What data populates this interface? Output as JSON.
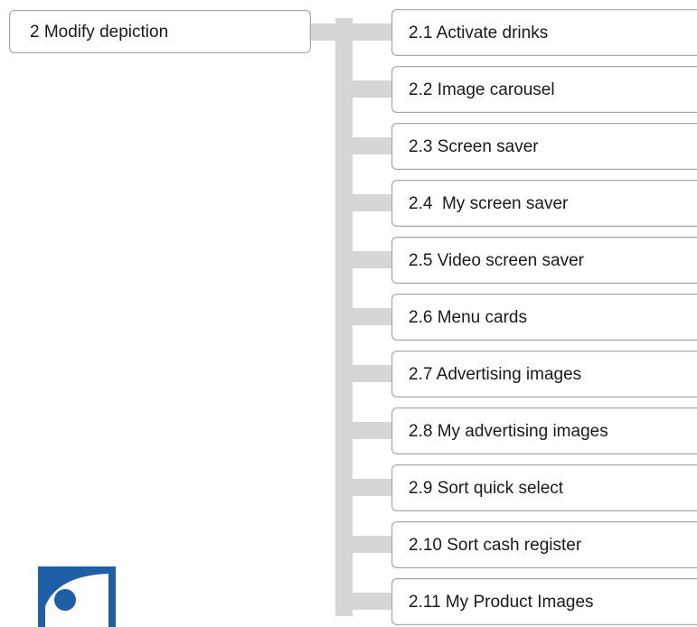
{
  "diagram": {
    "root": {
      "label": "2 Modify depiction"
    },
    "children": [
      {
        "label": "2.1 Activate drinks"
      },
      {
        "label": "2.2 Image carousel"
      },
      {
        "label": "2.3 Screen saver"
      },
      {
        "label": "2.4  My screen saver"
      },
      {
        "label": "2.5 Video screen saver"
      },
      {
        "label": "2.6 Menu cards"
      },
      {
        "label": "2.7 Advertising images"
      },
      {
        "label": "2.8 My advertising images"
      },
      {
        "label": "2.9 Sort quick select"
      },
      {
        "label": "2.10 Sort cash register"
      },
      {
        "label": "2.11 My Product Images"
      }
    ],
    "colors": {
      "connector": "#d6d6d6",
      "node_border": "#a8a8a8",
      "logo_blue": "#1f5fa8"
    },
    "logo_icon": "brand-logo-icon"
  }
}
